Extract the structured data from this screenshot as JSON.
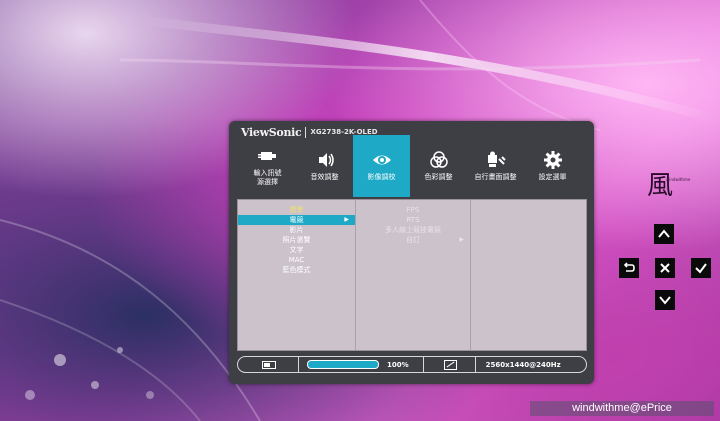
{
  "osd": {
    "brand": "ViewSonic",
    "model": "XG2738-2K-OLED",
    "tabs": [
      {
        "label": "輸入訊號\n源選擇",
        "icon": "input-source-icon"
      },
      {
        "label": "音效調整",
        "icon": "speaker-icon"
      },
      {
        "label": "影像調校",
        "icon": "eye-icon",
        "active": true
      },
      {
        "label": "色彩調整",
        "icon": "color-circles-icon"
      },
      {
        "label": "自行畫面調整",
        "icon": "manual-image-icon"
      },
      {
        "label": "設定選單",
        "icon": "gear-icon"
      }
    ],
    "menu_col1": [
      "標準",
      "電競",
      "影片",
      "照片瀏覽",
      "文字",
      "MAC",
      "藍色模式"
    ],
    "menu_col1_selected": 1,
    "menu_col2": [
      "FPS",
      "RTS",
      "多人線上競技電競",
      "自訂"
    ],
    "status": {
      "brightness_pct": "100%",
      "brightness_level": 1.0,
      "resolution": "2560x1440@240Hz"
    }
  },
  "logo": {
    "glyph": "風",
    "subtitle": "windwithme"
  },
  "watermark": "windwithme@ePrice",
  "colors": {
    "accent": "#1ea9c6",
    "panel": "#3e3e45",
    "content": "#cbc2cb"
  }
}
